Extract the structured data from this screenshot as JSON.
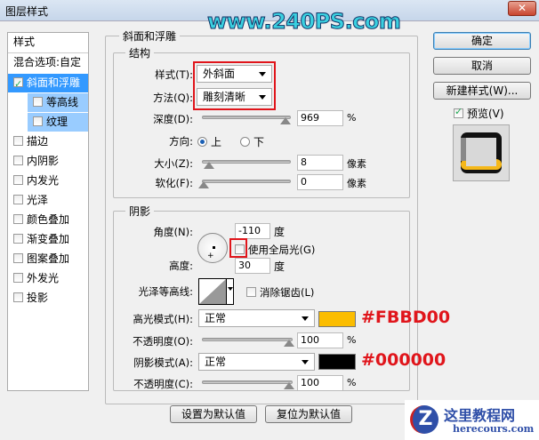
{
  "window": {
    "title": "图层样式",
    "watermark": "www.240PS.com"
  },
  "sidebar": {
    "header": "样式",
    "blend_options": "混合选项:自定",
    "items": [
      {
        "label": "斜面和浮雕",
        "checked": true,
        "selected": true
      },
      {
        "label": "等高线",
        "checked": false,
        "sub": true
      },
      {
        "label": "纹理",
        "checked": false,
        "sub": true
      },
      {
        "label": "描边",
        "checked": false
      },
      {
        "label": "内阴影",
        "checked": false
      },
      {
        "label": "内发光",
        "checked": false
      },
      {
        "label": "光泽",
        "checked": false
      },
      {
        "label": "颜色叠加",
        "checked": false
      },
      {
        "label": "渐变叠加",
        "checked": false
      },
      {
        "label": "图案叠加",
        "checked": false
      },
      {
        "label": "外发光",
        "checked": false
      },
      {
        "label": "投影",
        "checked": false
      }
    ]
  },
  "bevel": {
    "title": "斜面和浮雕",
    "structure": {
      "title": "结构",
      "style_label": "样式(T):",
      "style_value": "外斜面",
      "technique_label": "方法(Q):",
      "technique_value": "雕刻清晰",
      "depth_label": "深度(D):",
      "depth_value": "969",
      "depth_unit": "%",
      "depth_fraction": 0.97,
      "direction_label": "方向:",
      "dir_up": "上",
      "dir_down": "下",
      "size_label": "大小(Z):",
      "size_value": "8",
      "size_unit": "像素",
      "size_fraction": 0.08,
      "soften_label": "软化(F):",
      "soften_value": "0",
      "soften_unit": "像素",
      "soften_fraction": 0
    },
    "shading": {
      "title": "阴影",
      "angle_label": "角度(N):",
      "angle_value": "-110",
      "angle_unit": "度",
      "global_light": "使用全局光(G)",
      "altitude_label": "高度:",
      "altitude_value": "30",
      "altitude_unit": "度",
      "gloss_label": "光泽等高线:",
      "antialias": "消除锯齿(L)",
      "highlight_label": "高光模式(H):",
      "highlight_mode": "正常",
      "highlight_color": "#FBBD00",
      "highlight_hex": "#FBBD00",
      "hopacity_label": "不透明度(O):",
      "hopacity_value": "100",
      "shadow_label": "阴影模式(A):",
      "shadow_mode": "正常",
      "shadow_color": "#000000",
      "shadow_hex": "#000000",
      "sopacity_label": "不透明度(C):",
      "sopacity_value": "100",
      "pct": "%"
    },
    "make_default": "设置为默认值",
    "reset_default": "复位为默认值"
  },
  "buttons": {
    "ok": "确定",
    "cancel": "取消",
    "new_style": "新建样式(W)...",
    "preview": "预览(V)"
  },
  "logo": {
    "name": "这里教程网",
    "url": "herecours.com"
  }
}
